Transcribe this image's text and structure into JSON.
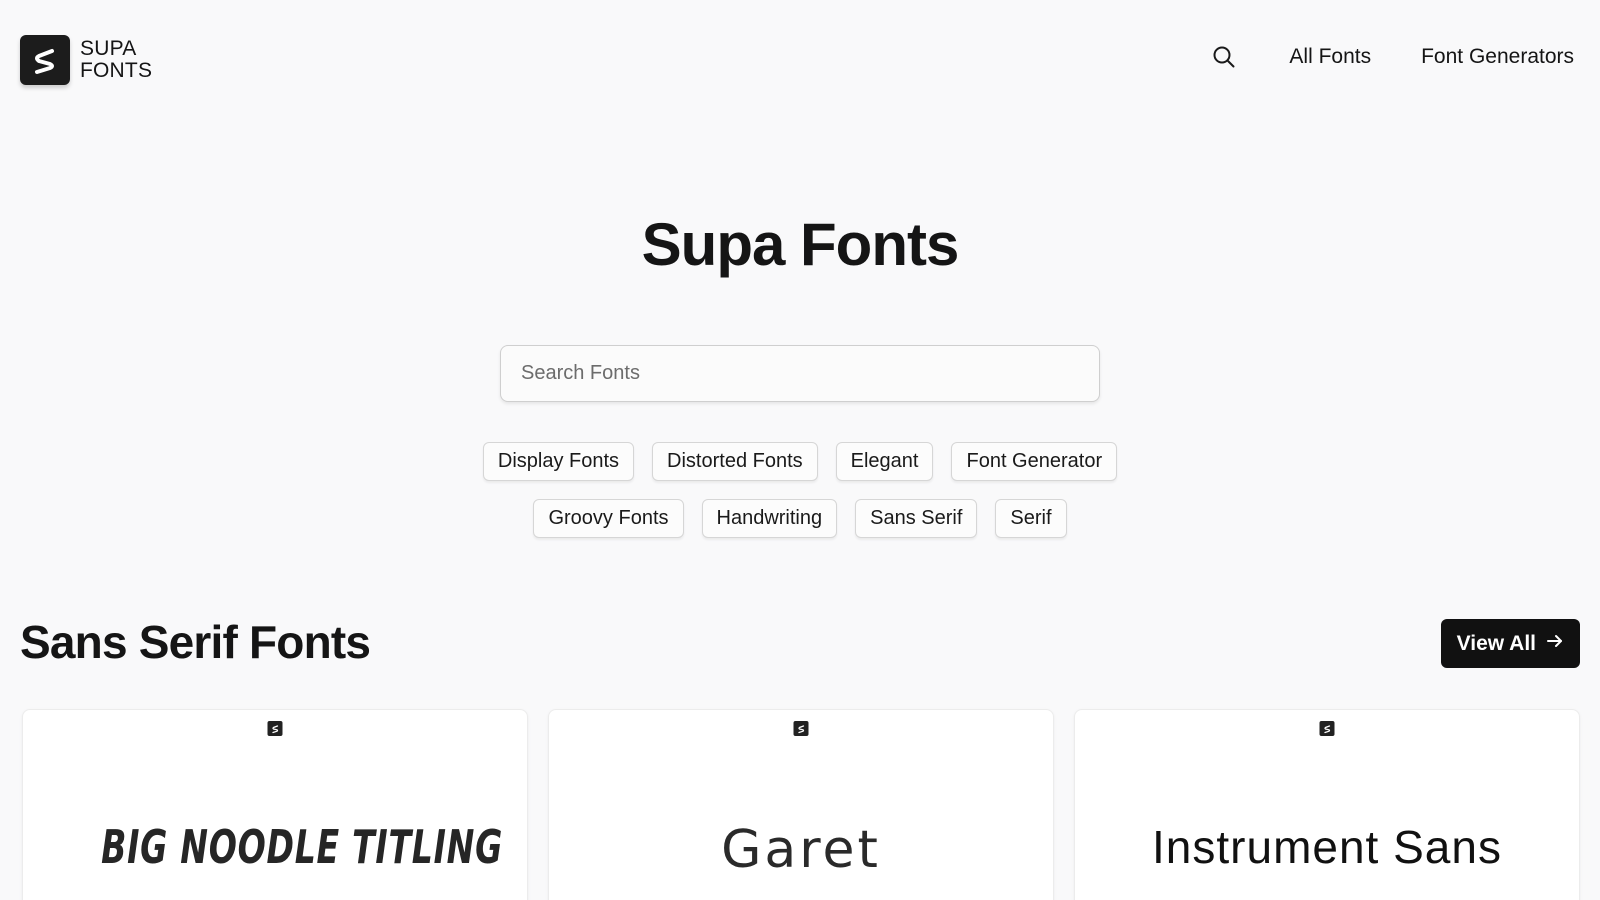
{
  "header": {
    "logo": {
      "line1": "SUPA",
      "line2": "FONTS"
    },
    "nav": {
      "all_fonts": "All Fonts",
      "font_generators": "Font Generators"
    },
    "search_icon": "search-icon"
  },
  "hero": {
    "title": "Supa Fonts",
    "search_placeholder": "Search Fonts",
    "tags_row1": [
      "Display Fonts",
      "Distorted Fonts",
      "Elegant",
      "Font Generator"
    ],
    "tags_row2": [
      "Groovy Fonts",
      "Handwriting",
      "Sans Serif",
      "Serif"
    ]
  },
  "section": {
    "title": "Sans Serif Fonts",
    "view_all": "View All",
    "view_all_icon": "arrow-right-icon",
    "cards": [
      {
        "sample": "BIG NOODLE TITLING"
      },
      {
        "sample": "Garet"
      },
      {
        "sample": "Instrument Sans"
      }
    ]
  },
  "colors": {
    "background": "#f9f9fa",
    "text": "#151515",
    "button": "#111111"
  }
}
